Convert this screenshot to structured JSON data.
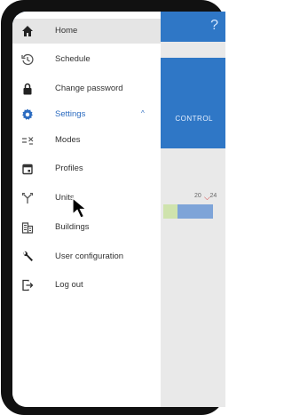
{
  "header": {
    "help_icon_label": "?"
  },
  "background_app": {
    "control_label": "CONTROL",
    "slider_value_label": "20",
    "slider_max_label": "24"
  },
  "menu": {
    "items": [
      {
        "label": "Home",
        "icon": "home-icon"
      },
      {
        "label": "Schedule",
        "icon": "history-icon"
      },
      {
        "label": "Change password",
        "icon": "lock-icon"
      },
      {
        "label": "Settings",
        "icon": "gear-icon",
        "expanded": true
      },
      {
        "label": "Modes",
        "icon": "modes-icon"
      },
      {
        "label": "Profiles",
        "icon": "calendar-icon"
      },
      {
        "label": "Units",
        "icon": "fork-icon"
      },
      {
        "label": "Buildings",
        "icon": "building-icon"
      },
      {
        "label": "User configuration",
        "icon": "wrench-icon"
      },
      {
        "label": "Log out",
        "icon": "logout-icon"
      }
    ],
    "settings_caret": "^"
  },
  "colors": {
    "accent": "#2b6bc0",
    "header_blue": "#2f77c6",
    "active_bg": "#e5e5e5"
  }
}
